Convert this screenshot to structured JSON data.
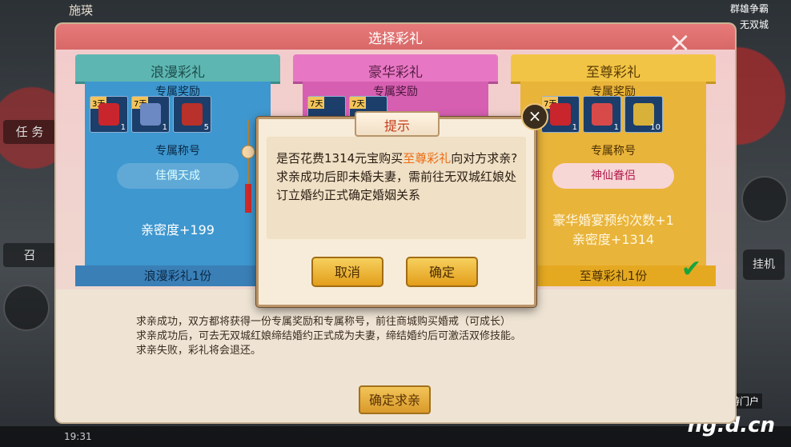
{
  "background": {
    "top_left_text": "施瑛",
    "top_right_text": "群雄争霸",
    "top_right_sub": "无双城",
    "left_button_task": "任 务",
    "left_button_summon": "召",
    "right_button_hangup": "挂机",
    "bottom_time": "19:31",
    "watermark_site": "当乐网游门户",
    "watermark_domain": "ng.d.cn"
  },
  "dialog": {
    "title": "选择彩礼",
    "close_label": "×",
    "columns": [
      {
        "name": "浪漫彩礼",
        "reward_label": "专属奖励",
        "rewards": [
          {
            "tag": "3天",
            "count": "1"
          },
          {
            "tag": "7天",
            "count": "1"
          },
          {
            "tag": "",
            "count": "5"
          }
        ],
        "title_label": "专属称号",
        "title_badge": "佳偶天成",
        "intimacy": "亲密度+199",
        "footer": "浪漫彩礼1份"
      },
      {
        "name": "豪华彩礼",
        "reward_label": "专属奖励",
        "rewards": [
          {
            "tag": "7天",
            "count": ""
          },
          {
            "tag": "7天",
            "count": ""
          }
        ]
      },
      {
        "name": "至尊彩礼",
        "reward_label": "专属奖励",
        "rewards": [
          {
            "tag": "7天",
            "count": "1"
          },
          {
            "tag": "",
            "count": "1"
          },
          {
            "tag": "",
            "count": "10"
          }
        ],
        "title_label": "专属称号",
        "title_badge": "神仙眷侣",
        "extra_line": "豪华婚宴预约次数+1",
        "intimacy": "亲密度+1314",
        "footer": "至尊彩礼1份"
      }
    ],
    "rules": [
      "求亲成功，双方都将获得一份专属奖励和专属称号，前往商城购买婚戒（可成长）",
      "求亲成功后，可去无双城红娘缔结婚约正式成为夫妻，缔结婚约后可激活双修技能。",
      "求亲失败，彩礼将会退还。"
    ],
    "confirm_button": "确定求亲"
  },
  "prompt": {
    "title": "提示",
    "close_label": "×",
    "message_prefix": "是否花费1314元宝购买",
    "message_highlight": "至尊彩礼",
    "message_suffix": "向对方求亲?",
    "message_line2": "求亲成功后即未婚夫妻，需前往无双城红娘处订立婚约正式确定婚姻关系",
    "cancel_button": "取消",
    "ok_button": "确定"
  }
}
